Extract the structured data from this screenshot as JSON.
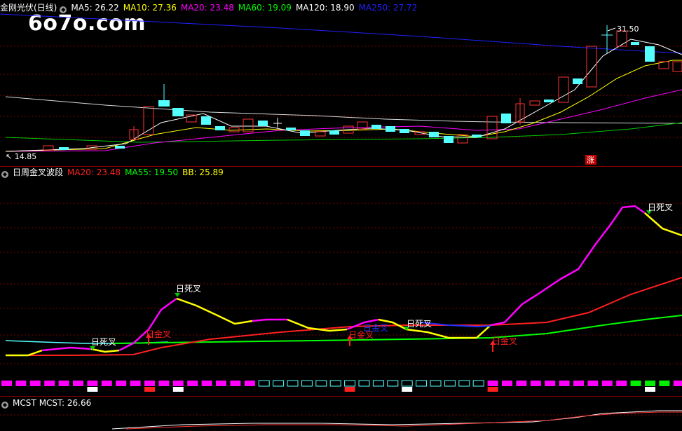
{
  "panel1": {
    "title": "金刚光伏(日线)",
    "items": [
      {
        "label": "MA5: 26.22",
        "color": "#ffffff"
      },
      {
        "label": "MA10: 27.36",
        "color": "#ffff00"
      },
      {
        "label": "MA20: 23.48",
        "color": "#ff00ff"
      },
      {
        "label": "MA60: 19.09",
        "color": "#00ff00"
      },
      {
        "label": "MA120: 18.90",
        "color": "#ffffff"
      },
      {
        "label": "MA250: 27.72",
        "color": "#0000ff"
      }
    ],
    "high_label": "31.50",
    "low_label": "14.85",
    "zhang_label": "涨"
  },
  "watermark": "6o7o.com",
  "panel2": {
    "title": "日周金叉波段",
    "items": [
      {
        "label": "MA20: 23.48",
        "color": "#ff2020"
      },
      {
        "label": "MA55: 19.50",
        "color": "#00ff00"
      },
      {
        "label": "BB: 25.89",
        "color": "#ffff00"
      }
    ],
    "annotations": [
      {
        "text": "日死叉",
        "color": "#ffffff"
      },
      {
        "text": "日死叉",
        "color": "#ffffff"
      },
      {
        "text": "日金叉",
        "color": "#ff2020"
      },
      {
        "text": "日金叉",
        "color": "#ff2020"
      },
      {
        "text": "日金叉",
        "color": "#2030ff"
      },
      {
        "text": "日死叉",
        "color": "#ffffff"
      },
      {
        "text": "日金叉",
        "color": "#ff2020"
      },
      {
        "text": "日死叉",
        "color": "#ffffff"
      }
    ]
  },
  "panel3": {
    "title": "MCST",
    "value": "MCST: 26.66"
  },
  "colors": {
    "up": "#ff3333",
    "down": "#54ffff",
    "grid": "#8b0000",
    "magenta": "#ff00ff",
    "yellow": "#ffff00",
    "green": "#00ff00",
    "red": "#ff2020"
  }
}
